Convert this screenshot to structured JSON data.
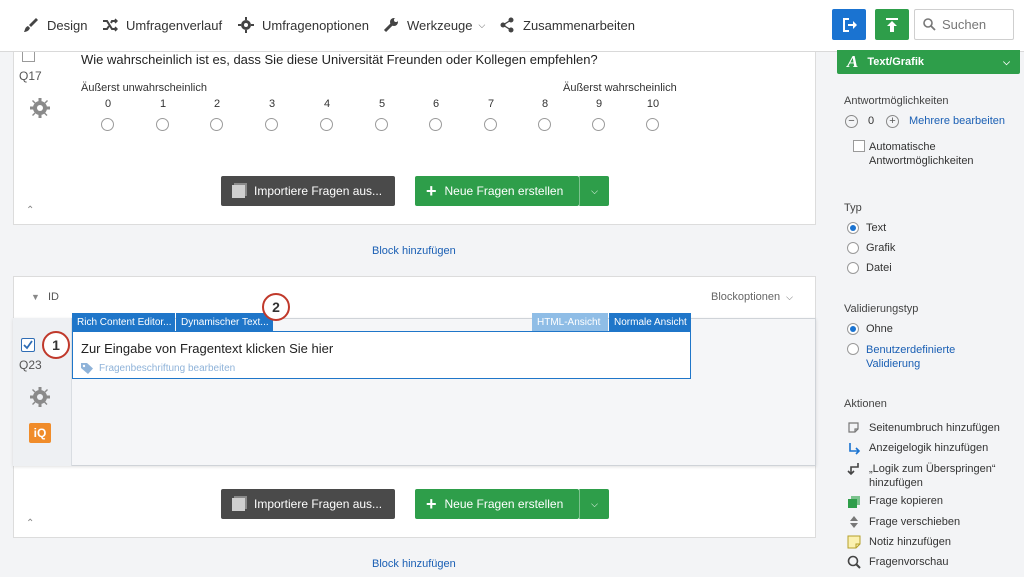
{
  "nav": {
    "design": "Design",
    "history": "Umfragenverlauf",
    "options": "Umfragenoptionen",
    "tools": "Werkzeuge",
    "collab": "Zusammenarbeiten",
    "search_placeholder": "Suchen"
  },
  "block1": {
    "question_number": "Q17",
    "question_text": "Wie wahrscheinlich ist es, dass Sie diese Universität Freunden oder Kollegen empfehlen?",
    "low_label": "Äußerst unwahrscheinlich",
    "high_label": "Äußerst wahrscheinlich",
    "scale": [
      "0",
      "1",
      "2",
      "3",
      "4",
      "5",
      "6",
      "7",
      "8",
      "9",
      "10"
    ],
    "import_label": "Importiere Fragen aus...",
    "new_label": "Neue Fragen erstellen"
  },
  "add_block_1": "Block hinzufügen",
  "block2": {
    "name": "ID",
    "options": "Blockoptionen",
    "tab_rich": "Rich Content Editor...",
    "tab_dynamic": "Dynamischer Text...",
    "tab_html": "HTML-Ansicht",
    "tab_normal": "Normale Ansicht",
    "question_number": "Q23",
    "question_placeholder": "Zur Eingabe von Fragentext klicken Sie hier",
    "label_edit": "Fragenbeschriftung bearbeiten",
    "iq_badge": "iQ",
    "callout_1": "1",
    "callout_2": "2",
    "import_label": "Importiere Fragen aus...",
    "new_label": "Neue Fragen erstellen"
  },
  "add_block_2": "Block hinzufügen",
  "panel": {
    "question_type": "Text/Grafik",
    "qtype_glyph": "A",
    "choices_heading": "Antwortmöglichkeiten",
    "choices_count": "0",
    "edit_multiple": "Mehrere bearbeiten",
    "auto_choices": "Automatische Antwortmöglichkeiten",
    "type_heading": "Typ",
    "types": [
      "Text",
      "Grafik",
      "Datei"
    ],
    "validation_heading": "Validierungstyp",
    "validation_none": "Ohne",
    "validation_custom": "Benutzerdefinierte Validierung",
    "actions_heading": "Aktionen",
    "actions": [
      "Seitenumbruch hinzufügen",
      "Anzeigelogik hinzufügen",
      "„Logik zum Überspringen“ hinzufügen",
      "Frage kopieren",
      "Frage verschieben",
      "Notiz hinzufügen",
      "Fragenvorschau"
    ]
  },
  "colors": {
    "blue": "#1a73d1",
    "green": "#2e9e4a",
    "callout_red": "#c0392b",
    "iq_orange": "#f08c2a"
  }
}
